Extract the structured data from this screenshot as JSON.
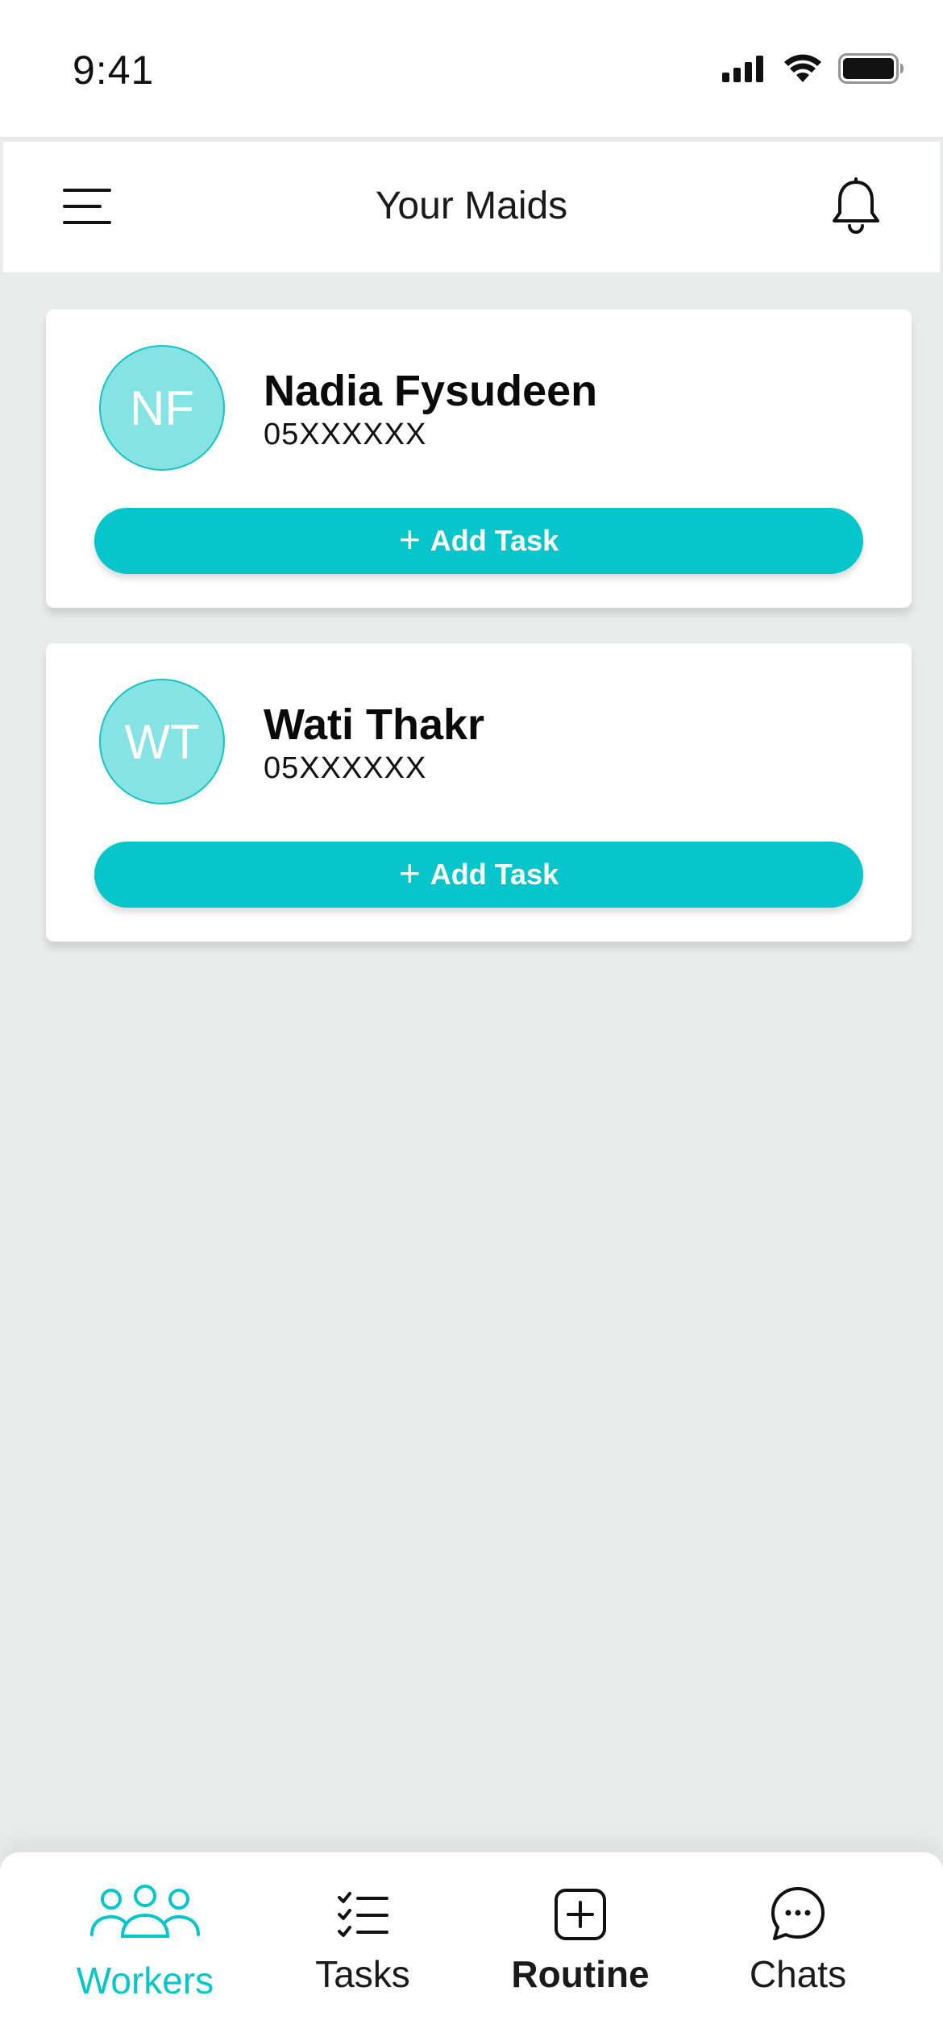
{
  "status_bar": {
    "time": "9:41"
  },
  "header": {
    "title": "Your Maids"
  },
  "maids": [
    {
      "initials": "NF",
      "name": "Nadia Fysudeen",
      "phone": "05XXXXXX",
      "add_task_label": "Add Task"
    },
    {
      "initials": "WT",
      "name": "Wati Thakr",
      "phone": "05XXXXXX",
      "add_task_label": "Add Task"
    }
  ],
  "bottom_nav": {
    "items": [
      {
        "label": "Workers",
        "icon": "workers-icon",
        "active": true
      },
      {
        "label": "Tasks",
        "icon": "tasks-icon",
        "active": false
      },
      {
        "label": "Routine",
        "icon": "routine-icon",
        "active": false
      },
      {
        "label": "Chats",
        "icon": "chats-icon",
        "active": false
      }
    ]
  },
  "colors": {
    "accent": "#06c6cb",
    "avatar_fill": "#85e3e3",
    "background": "#eaecec"
  }
}
